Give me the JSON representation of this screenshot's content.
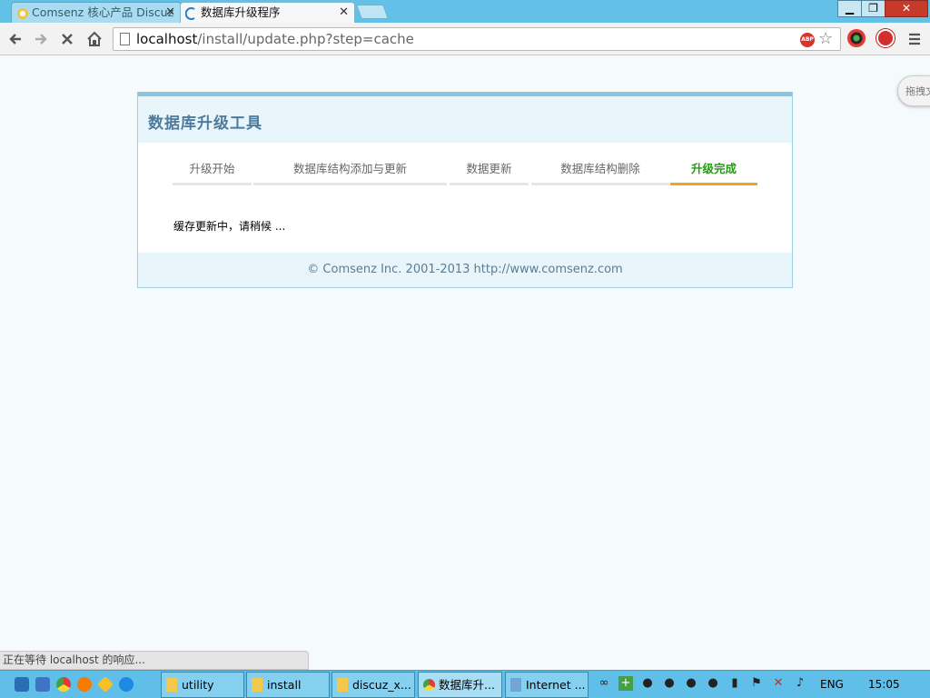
{
  "browser": {
    "tabs": [
      {
        "title": "Comsenz 核心产品 Discuz",
        "active": false
      },
      {
        "title": "数据库升级程序",
        "active": true
      }
    ],
    "address": {
      "host": "localhost",
      "path": "/install/update.php?step=cache"
    },
    "window_buttons": {
      "minimize": "▁",
      "maximize": "❐",
      "close": "✕"
    },
    "extensions": {
      "abp": "ABP"
    }
  },
  "side_widget": {
    "label": "拖拽文"
  },
  "installer": {
    "title": "数据库升级工具",
    "steps": [
      {
        "label": "升级开始",
        "current": false
      },
      {
        "label": "数据库结构添加与更新",
        "current": false
      },
      {
        "label": "数据更新",
        "current": false
      },
      {
        "label": "数据库结构删除",
        "current": false
      },
      {
        "label": "升级完成",
        "current": true
      }
    ],
    "message": "缓存更新中，请稍候 ...",
    "footer": "© Comsenz Inc. 2001-2013 http://www.comsenz.com"
  },
  "status_bar": {
    "text": "正在等待 localhost 的响应..."
  },
  "taskbar": {
    "items": [
      {
        "label": "utility"
      },
      {
        "label": "install"
      },
      {
        "label": "discuz_x..."
      },
      {
        "label": "数据库升..."
      },
      {
        "label": "Internet ..."
      }
    ],
    "language": "ENG",
    "time": "15:05"
  },
  "colors": {
    "accent_blue": "#63c0e6",
    "title_text": "#4f7b9c",
    "current_step_text": "#229a13",
    "current_step_underline": "#f0a517"
  }
}
